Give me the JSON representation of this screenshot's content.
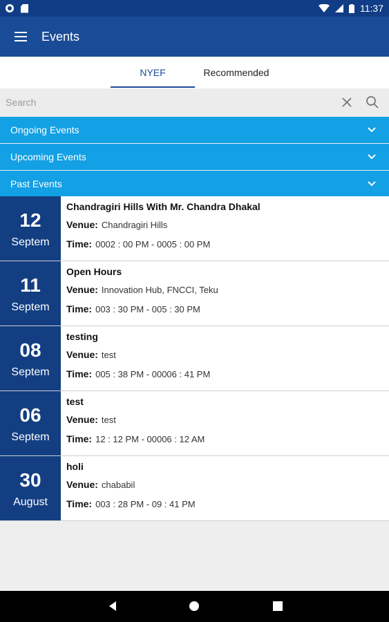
{
  "status_bar": {
    "time": "11:37",
    "battery": "▮"
  },
  "app_bar": {
    "title": "Events"
  },
  "tabs": [
    {
      "label": "NYEF"
    },
    {
      "label": "Recommended"
    }
  ],
  "search": {
    "placeholder": "Search"
  },
  "sections": [
    {
      "label": "Ongoing Events"
    },
    {
      "label": "Upcoming Events"
    },
    {
      "label": "Past Events"
    }
  ],
  "labels": {
    "venue": "Venue:",
    "time": "Time:"
  },
  "events": [
    {
      "day": "12",
      "month": "Septem",
      "title": "Chandragiri Hills With Mr. Chandra Dhakal",
      "venue": "Chandragiri Hills",
      "time": "0002 : 00 PM - 0005 : 00 PM"
    },
    {
      "day": "11",
      "month": "Septem",
      "title": "Open Hours",
      "venue": "Innovation Hub, FNCCI, Teku",
      "time": "003 : 30 PM - 005 : 30 PM"
    },
    {
      "day": "08",
      "month": "Septem",
      "title": "testing",
      "venue": "test",
      "time": "005 : 38 PM - 00006 : 41 PM"
    },
    {
      "day": "06",
      "month": "Septem",
      "title": "test",
      "venue": "test",
      "time": "12 : 12 PM - 00006 : 12 AM"
    },
    {
      "day": "30",
      "month": "August",
      "title": "holi",
      "venue": "chababil",
      "time": "003 : 28 PM - 09 : 41 PM"
    }
  ],
  "colors": {
    "primary": "#1a4b96",
    "status": "#113d86",
    "accent": "#13a0e4",
    "date_box": "#133f82"
  }
}
